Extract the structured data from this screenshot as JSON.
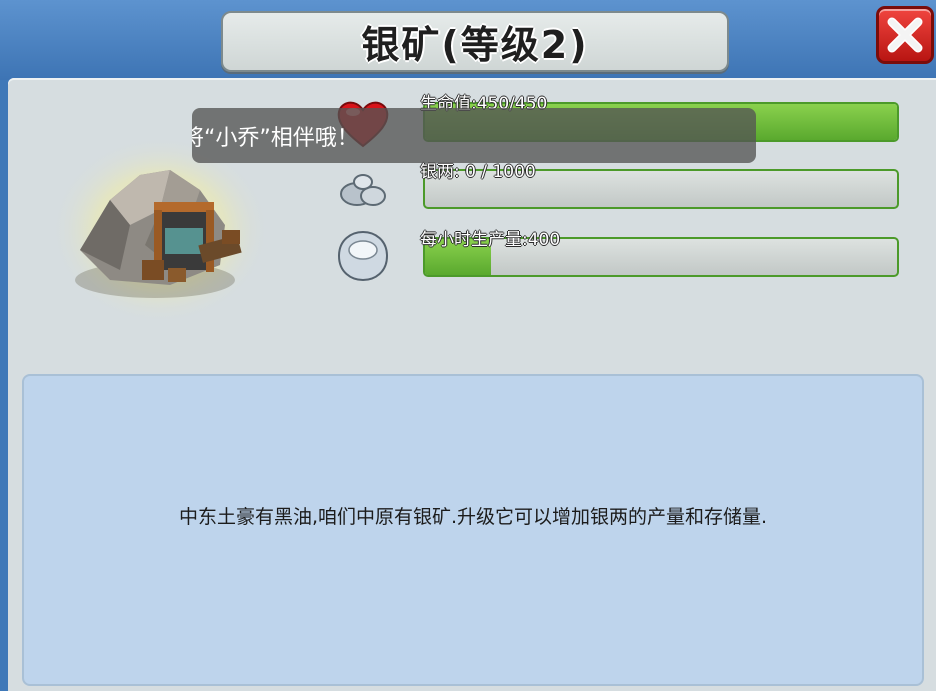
{
  "dialog": {
    "title": "银矿(等级2)",
    "close_icon": "close-x-icon"
  },
  "building": {
    "icon": "silver-mine-icon"
  },
  "stats": [
    {
      "label": "生命值:450/450",
      "icon": "heart-icon",
      "fill": 1.0
    },
    {
      "label": "银两: 0 / 1000",
      "icon": "silver-ore-icon",
      "fill": 0.0
    },
    {
      "label": "每小时生产量:400",
      "icon": "silver-ingot-icon",
      "fill": 0.14
    }
  ],
  "toast": {
    "text": "将“小乔”相伴哦！"
  },
  "description": {
    "text": "中东土豪有黑油,咱们中原有银矿.升级它可以增加银两的产量和存储量."
  },
  "colors": {
    "bar_fill": "#6cbd38",
    "bar_border": "#4c9a2a",
    "close": "#d8231f",
    "desc_bg": "#bed4ec"
  }
}
